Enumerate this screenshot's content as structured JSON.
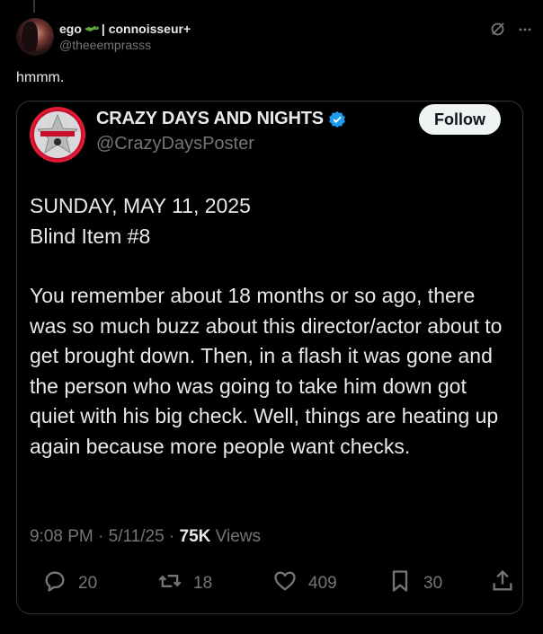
{
  "outer_tweet": {
    "display_name_start": "ego",
    "display_name_end": "| connoisseur+",
    "handle": "@theeemprasss",
    "text": "hmmm.",
    "icons": [
      "grok-icon",
      "more-icon"
    ]
  },
  "quoted_tweet": {
    "display_name": "CRAZY DAYS AND NIGHTS",
    "handle": "@CrazyDaysPoster",
    "follow_label": "Follow",
    "verified": true,
    "body_line_1": "SUNDAY, MAY 11, 2025",
    "body_line_2": "Blind Item #8",
    "body_paragraph": "You remember about 18 months or so ago, there was so much buzz about this director/actor about to get brought down. Then, in a flash it was gone and the person who was going to take him down got quiet with his big check. Well, things are heating up again because more people want checks.",
    "time": "9:08 PM",
    "date": "5/11/25",
    "separator": "·",
    "views_count": "75K",
    "views_label": "Views",
    "actions": {
      "replies": "20",
      "reposts": "18",
      "likes": "409",
      "bookmarks": "30"
    }
  },
  "colors": {
    "background": "#000000",
    "text_primary": "#e7e9ea",
    "text_secondary": "#71767b",
    "verified": "#1d9bf0",
    "follow_bg": "#eff3f4",
    "border": "#2f3336"
  }
}
